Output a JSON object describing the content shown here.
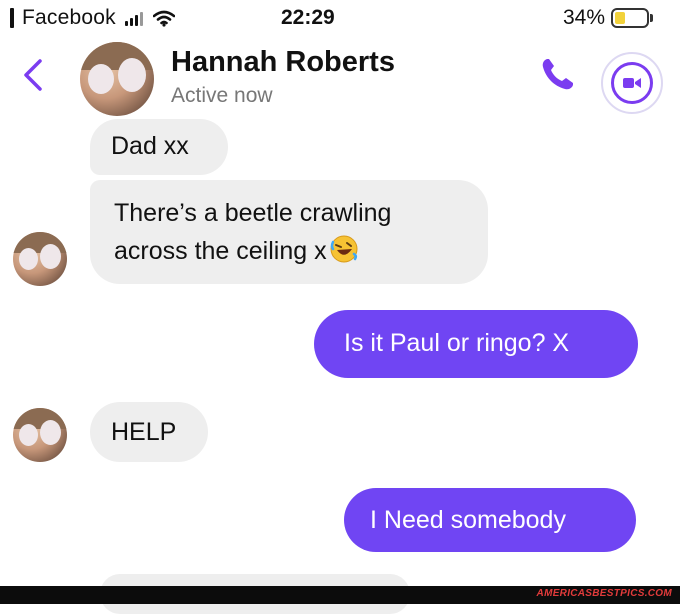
{
  "status_bar": {
    "carrier": "Facebook",
    "time": "22:29",
    "battery_percent": "34%",
    "battery_level": 0.34
  },
  "header": {
    "contact_name": "Hannah Roberts",
    "contact_status": "Active now",
    "back_icon": "chevron-left-icon",
    "call_icon": "phone-icon",
    "video_icon": "video-camera-icon"
  },
  "messages": [
    {
      "direction": "incoming",
      "text": "Dad xx"
    },
    {
      "direction": "incoming",
      "line1": "There’s a beetle crawling",
      "line2": "across the ceiling x",
      "emoji": "rofl-emoji"
    },
    {
      "direction": "outgoing",
      "text": "Is it Paul or ringo? X"
    },
    {
      "direction": "incoming",
      "text": "HELP"
    },
    {
      "direction": "outgoing",
      "text": "I Need somebody"
    }
  ],
  "watermark": "AMERICASBESTPICS.COM",
  "colors": {
    "accent": "#7b3cf0",
    "outgoing_bubble": "#7045f3",
    "incoming_bubble": "#eeeeee",
    "battery": "#f2d23b"
  }
}
